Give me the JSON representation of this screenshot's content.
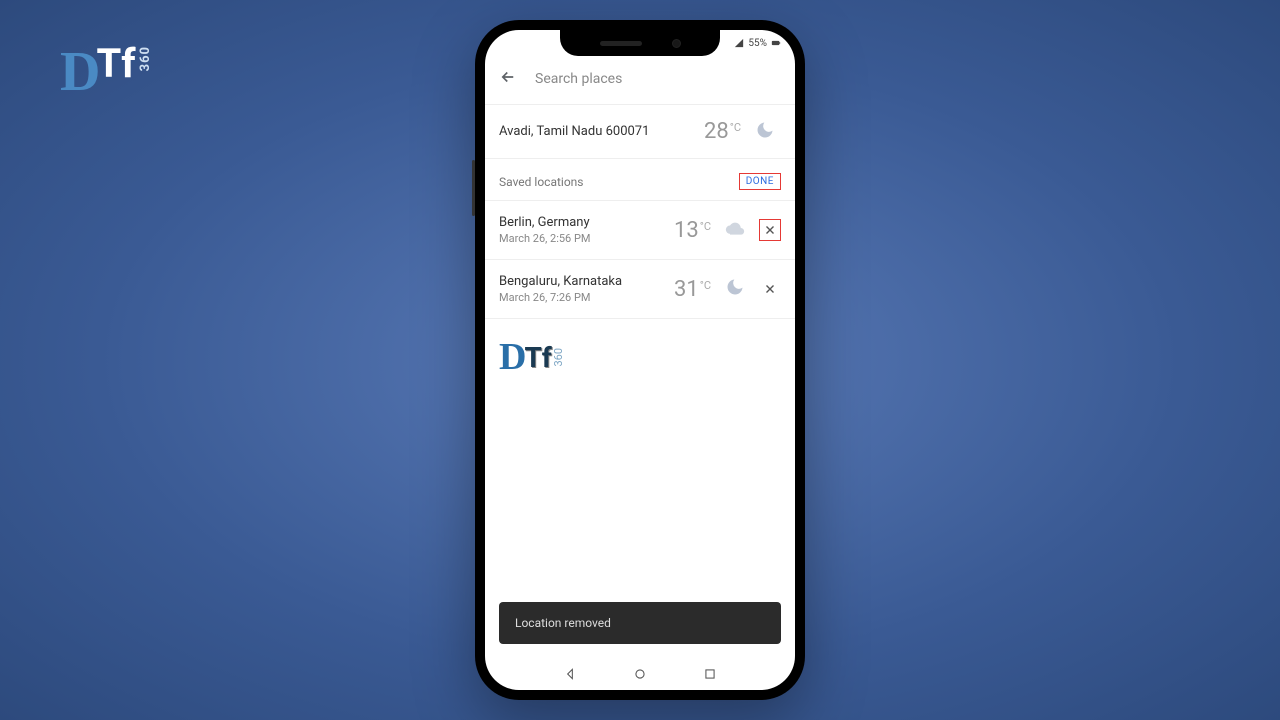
{
  "status": {
    "battery": "55%"
  },
  "search": {
    "placeholder": "Search places"
  },
  "current": {
    "name": "Avadi, Tamil Nadu 600071",
    "temp": "28",
    "unit": "°C"
  },
  "sections": {
    "saved_title": "Saved locations",
    "done_label": "DONE"
  },
  "saved": [
    {
      "name": "Berlin, Germany",
      "sub": "March 26, 2:56 PM",
      "temp": "13",
      "unit": "°C",
      "icon": "cloud",
      "highlight": true
    },
    {
      "name": "Bengaluru, Karnataka",
      "sub": "March 26, 7:26 PM",
      "temp": "31",
      "unit": "°C",
      "icon": "moon",
      "highlight": false
    }
  ],
  "toast": {
    "message": "Location removed"
  },
  "brand": {
    "d": "D",
    "t": "Tf",
    "num": "360"
  }
}
